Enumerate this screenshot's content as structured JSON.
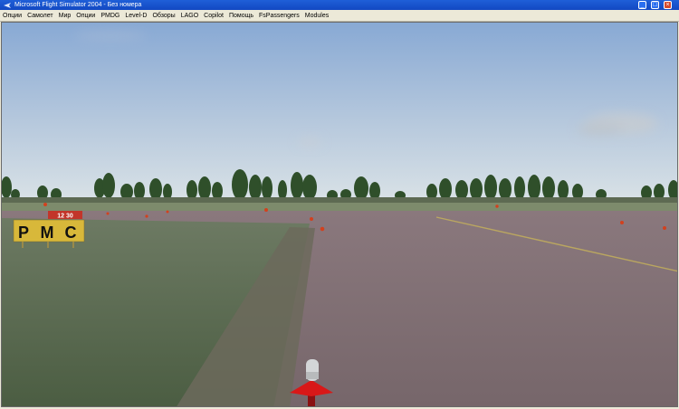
{
  "window": {
    "title": "Microsoft Flight Simulator 2004 - Без номера",
    "minimize_icon": "minimize-icon",
    "maximize_icon": "maximize-icon",
    "close_icon": "close-icon"
  },
  "menu": [
    "Опции",
    "Самолет",
    "Мир",
    "Опции",
    "PMDG",
    "Level-D",
    "Обзоры",
    "LAGO",
    "Copilot",
    "Помощь",
    "FsPassengers",
    "Modules"
  ],
  "scene": {
    "sign": {
      "runway_label": "12 30",
      "letters": [
        "P",
        "M",
        "C"
      ]
    }
  },
  "colors": {
    "titlebar": "#1a54d0",
    "sky_top": "#8fb0d8",
    "sky_horizon": "#d9e2e6",
    "tarmac": "#7c6a6e",
    "grass": "#56694a",
    "sign_yellow": "#d8b83a",
    "sign_red": "#c2352a",
    "light_red": "#d81818"
  }
}
